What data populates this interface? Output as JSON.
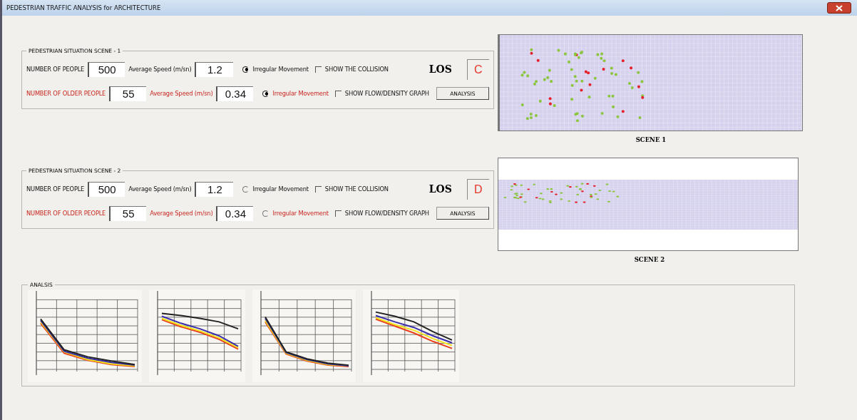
{
  "window": {
    "title": "PEDESTRIAN TRAFFIC ANALYSIS for ARCHITECTURE"
  },
  "scenes": [
    {
      "title": "PEDESTRIAN SITUATION SCENE - 1",
      "people_label": "NUMBER OF PEOPLE",
      "people": "500",
      "speed_label": "Average Speed (m/sn)",
      "speed": "1.2",
      "irregular": {
        "label": "Irregular Movement",
        "selected": true
      },
      "collision": {
        "label": "SHOW THE COLLISION",
        "checked": false
      },
      "los_label": "LOS",
      "los": "C",
      "older_label": "NUMBER OF OLDER PEOPLE",
      "older": "55",
      "older_speed_label": "Average Speed (m/sn)",
      "older_speed": "0.34",
      "older_irregular": {
        "label": "Irregular Movement",
        "selected": true
      },
      "graph": {
        "label": "SHOW FLOW/DENSITY GRAPH",
        "checked": false
      },
      "analysis_button": "ANALYSIS",
      "view_caption": "SCENE 1"
    },
    {
      "title": "PEDESTRIAN SITUATION SCENE - 2",
      "people_label": "NUMBER OF PEOPLE",
      "people": "500",
      "speed_label": "Average Speed (m/sn)",
      "speed": "1.2",
      "irregular": {
        "label": "Irregular Movement",
        "selected": false
      },
      "collision": {
        "label": "SHOW THE COLLISION",
        "checked": false
      },
      "los_label": "LOS",
      "los": "D",
      "older_label": "NUMBER OF OLDER PEOPLE",
      "older": "55",
      "older_speed_label": "Average Speed (m/sn)",
      "older_speed": "0.34",
      "older_irregular": {
        "label": "Irregular Movement",
        "selected": false
      },
      "graph": {
        "label": "SHOW FLOW/DENSITY GRAPH",
        "checked": false
      },
      "analysis_button": "ANALYSIS",
      "view_caption": "SCENE 2"
    }
  ],
  "analysis": {
    "title": "ANALSIS"
  }
}
